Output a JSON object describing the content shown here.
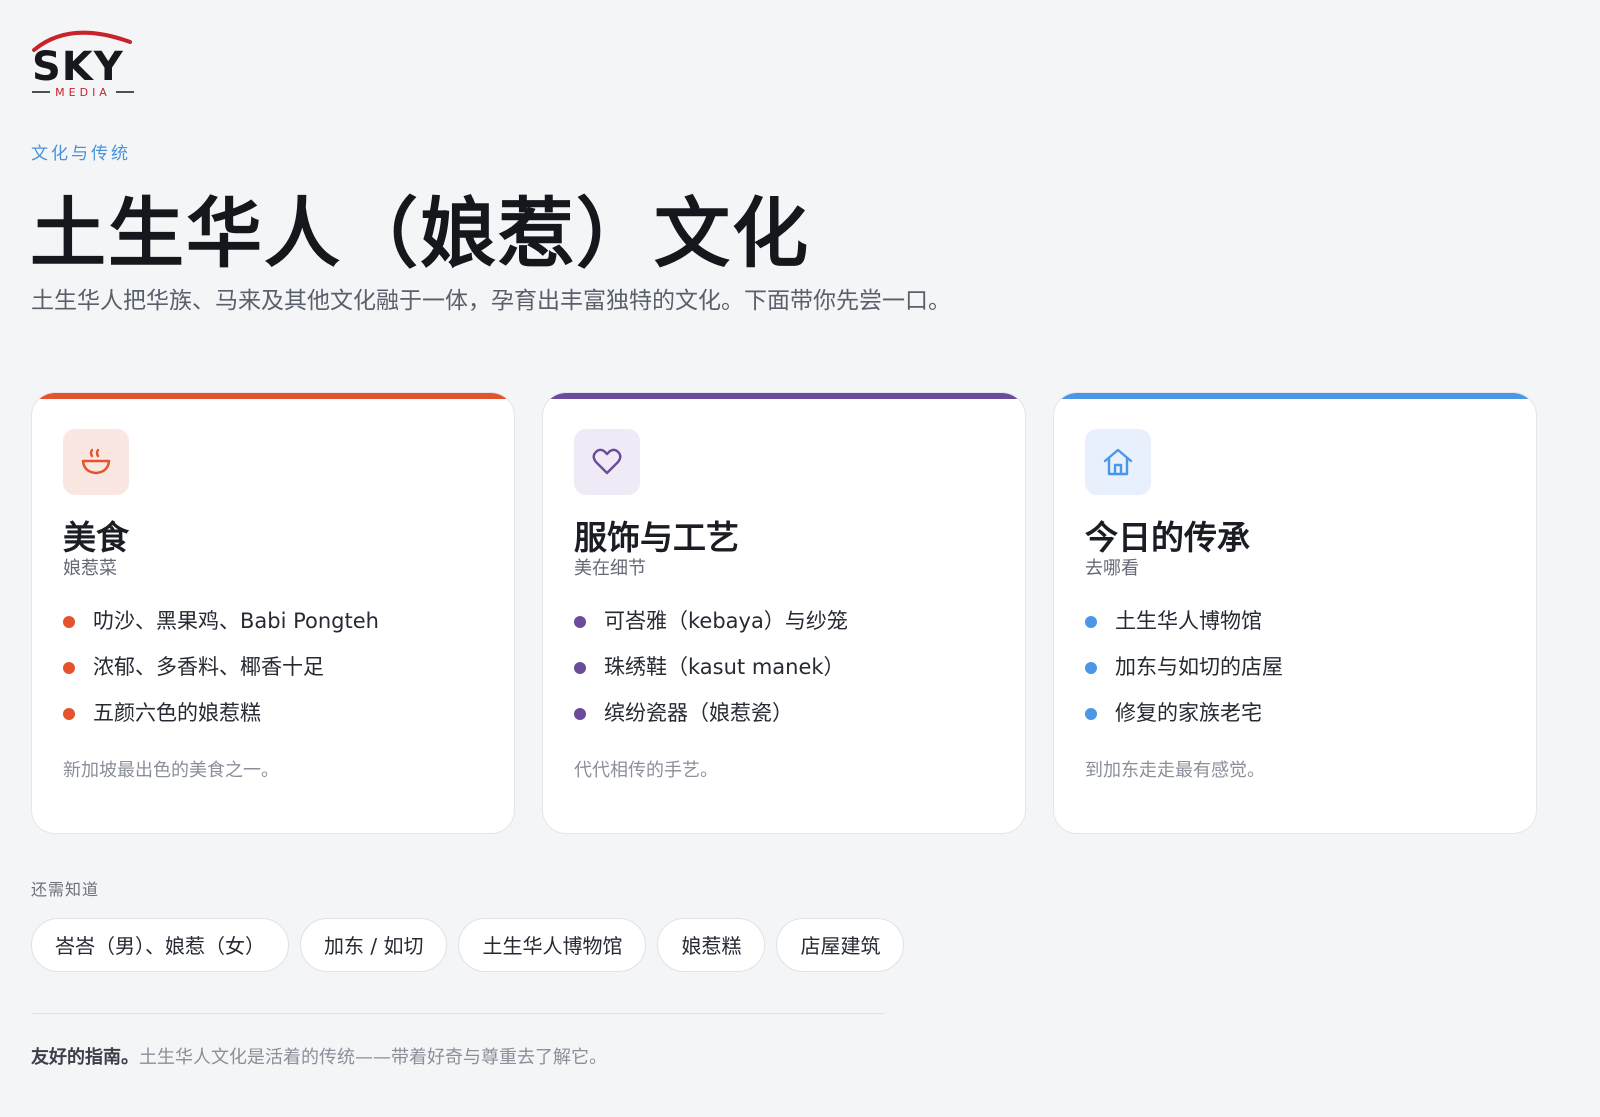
{
  "brand": {
    "logo_word": "SKY",
    "logo_sub": "MEDIA"
  },
  "header": {
    "eyebrow": "文化与传统",
    "title": "土生华人（娘惹）文化",
    "lead": "土生华人把华族、马来及其他文化融于一体，孕育出丰富独特的文化。下面带你先尝一口。"
  },
  "cards": [
    {
      "icon": "bowl-icon",
      "accent": "#e4532d",
      "tint": "#fbe7e1",
      "title": "美食",
      "subtitle": "娘惹菜",
      "items": [
        "叻沙、黑果鸡、Babi Pongteh",
        "浓郁、多香料、椰香十足",
        "五颜六色的娘惹糕"
      ],
      "note": "新加坡最出色的美食之一。"
    },
    {
      "icon": "heart-icon",
      "accent": "#6b4c9a",
      "tint": "#efeaf5",
      "title": "服饰与工艺",
      "subtitle": "美在细节",
      "items": [
        "可峇雅（kebaya）与纱笼",
        "珠绣鞋（kasut manek）",
        "缤纷瓷器（娘惹瓷）"
      ],
      "note": "代代相传的手艺。"
    },
    {
      "icon": "home-icon",
      "accent": "#4b97e6",
      "tint": "#e7f0fc",
      "title": "今日的传承",
      "subtitle": "去哪看",
      "items": [
        "土生华人博物馆",
        "加东与如切的店屋",
        "修复的家族老宅"
      ],
      "note": "到加东走走最有感觉。"
    }
  ],
  "needs": {
    "label": "还需知道",
    "chips": [
      "峇峇（男）、娘惹（女）",
      "加东 / 如切",
      "土生华人博物馆",
      "娘惹糕",
      "店屋建筑"
    ]
  },
  "footer": {
    "strong": "友好的指南。",
    "text": "土生华人文化是活着的传统——带着好奇与尊重去了解它。"
  }
}
